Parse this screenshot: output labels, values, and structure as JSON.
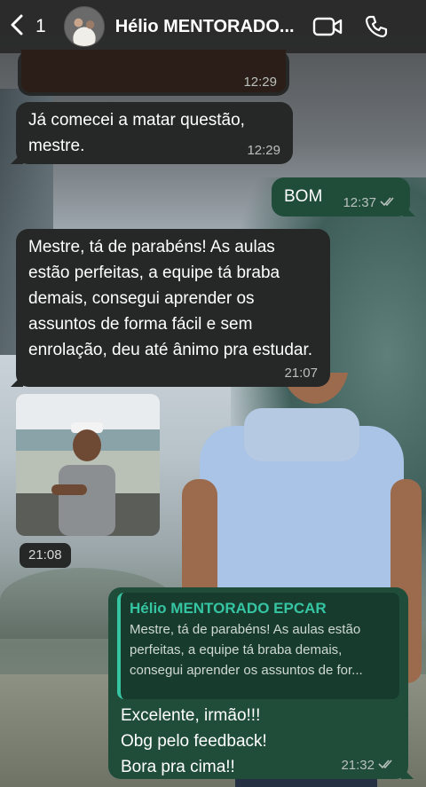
{
  "header": {
    "unread_count": "1",
    "contact_name": "Hélio MENTORADO..."
  },
  "messages": [
    {
      "type": "incoming_media",
      "time": "12:29"
    },
    {
      "type": "incoming",
      "text": "Já comecei a matar questão,\nmestre.",
      "time": "12:29"
    },
    {
      "type": "outgoing",
      "text": "BOM",
      "time": "12:37",
      "status": "read"
    },
    {
      "type": "incoming",
      "text": "Mestre, tá de parabéns! As aulas estão perfeitas, a equipe tá braba demais, consegui aprender os assuntos de forma fácil e sem enrolação, deu até ânimo pra estudar.",
      "time": "21:07"
    },
    {
      "type": "incoming_photo",
      "time": "21:08"
    },
    {
      "type": "outgoing_reply",
      "quoted_name": "Hélio MENTORADO EPCAR",
      "quoted_text": "Mestre, tá de parabéns! As aulas estão perfeitas, a equipe tá braba demais, consegui aprender os assuntos de for...",
      "text": "Excelente, irmão!!!\nObg pelo feedback!\nBora pra cima!!",
      "time": "21:32",
      "status": "read"
    }
  ],
  "icons": {
    "back": "chevron-left-icon",
    "video": "video-call-icon",
    "phone": "phone-call-icon",
    "read": "double-check-icon"
  },
  "colors": {
    "incoming_bubble": "#262727",
    "outgoing_bubble": "#1f4d3a",
    "quote_accent": "#36c5a3"
  }
}
